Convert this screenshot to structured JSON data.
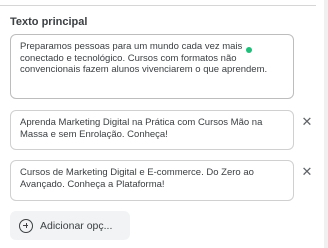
{
  "section": {
    "title": "Texto principal"
  },
  "options": [
    {
      "text": "Preparamos pessoas para um mundo cada vez mais conectado e tecnológico. Cursos com formatos não convencionais fazem alunos vivenciarem o que aprendem.",
      "removable": false
    },
    {
      "text": "Aprenda Marketing Digital na Prática com Cursos Mão na Massa e sem Enrolação. Conheça!",
      "removable": true
    },
    {
      "text": "Cursos de Marketing Digital e E-commerce. Do Zero ao Avançado. Conheça a Plataforma!",
      "removable": true
    }
  ],
  "remove_glyph": "✕",
  "add_button": {
    "label": "Adicionar opç..."
  },
  "colors": {
    "accent_dot": "#1fbf7a",
    "text": "#3c4043",
    "border": "#d0d0d0"
  }
}
